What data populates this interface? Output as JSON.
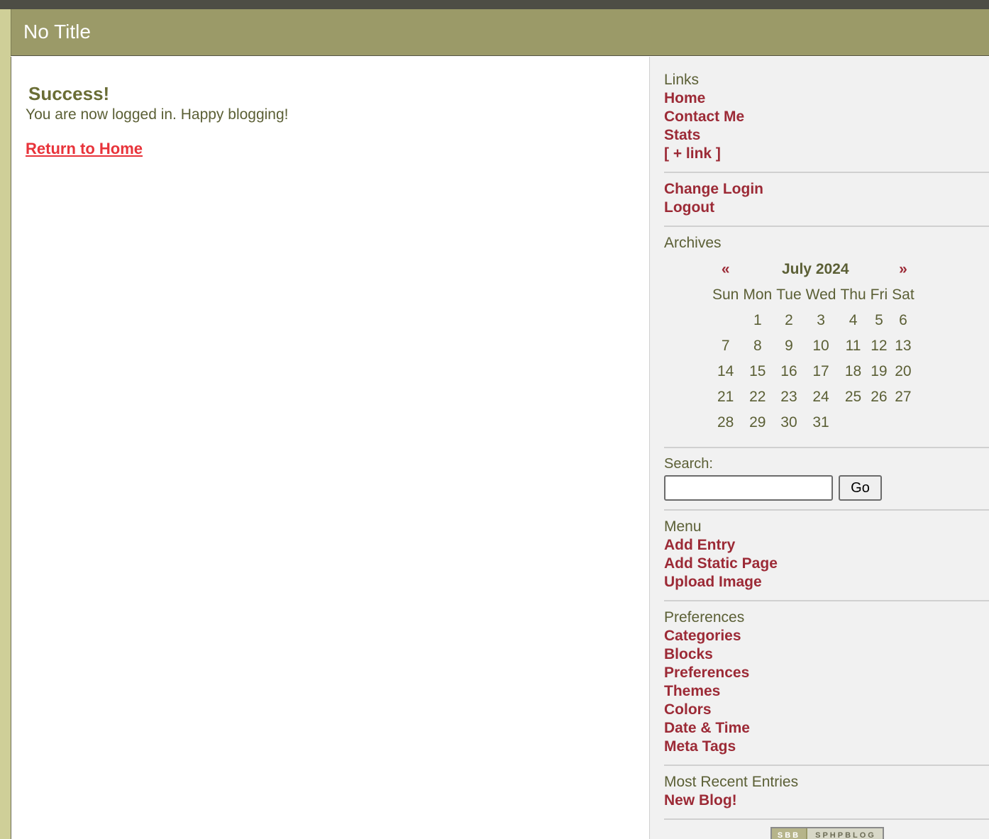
{
  "header": {
    "title": "No Title"
  },
  "main": {
    "heading": "Success!",
    "message": "You are now logged in. Happy blogging!",
    "return_link": "Return to Home"
  },
  "sidebar": {
    "links": {
      "title": "Links",
      "items": [
        "Home",
        "Contact Me",
        "Stats",
        "[ + link ]"
      ]
    },
    "account": {
      "items": [
        "Change Login",
        "Logout"
      ]
    },
    "archives": {
      "title": "Archives",
      "prev": "«",
      "next": "»",
      "month": "July 2024",
      "weekdays": [
        "Sun",
        "Mon",
        "Tue",
        "Wed",
        "Thu",
        "Fri",
        "Sat"
      ],
      "weeks": [
        [
          "",
          "1",
          "2",
          "3",
          "4",
          "5",
          "6"
        ],
        [
          "7",
          "8",
          "9",
          "10",
          "11",
          "12",
          "13"
        ],
        [
          "14",
          "15",
          "16",
          "17",
          "18",
          "19",
          "20"
        ],
        [
          "21",
          "22",
          "23",
          "24",
          "25",
          "26",
          "27"
        ],
        [
          "28",
          "29",
          "30",
          "31",
          "",
          "",
          ""
        ]
      ]
    },
    "search": {
      "label": "Search:",
      "value": "",
      "button": "Go"
    },
    "menu": {
      "title": "Menu",
      "items": [
        "Add Entry",
        "Add Static Page",
        "Upload Image"
      ]
    },
    "preferences": {
      "title": "Preferences",
      "items": [
        "Categories",
        "Blocks",
        "Preferences",
        "Themes",
        "Colors",
        "Date & Time",
        "Meta Tags"
      ]
    },
    "recent": {
      "title": "Most Recent Entries",
      "items": [
        "New Blog!"
      ]
    },
    "badge": {
      "left": "SBB",
      "right": "SPHPBLOG"
    }
  },
  "colors": {
    "header_bg": "#9b9a68",
    "link": "#9c2a36",
    "return_link": "#e8333a",
    "text": "#5b5f35",
    "sidebar_bg": "#f1f1f1"
  }
}
